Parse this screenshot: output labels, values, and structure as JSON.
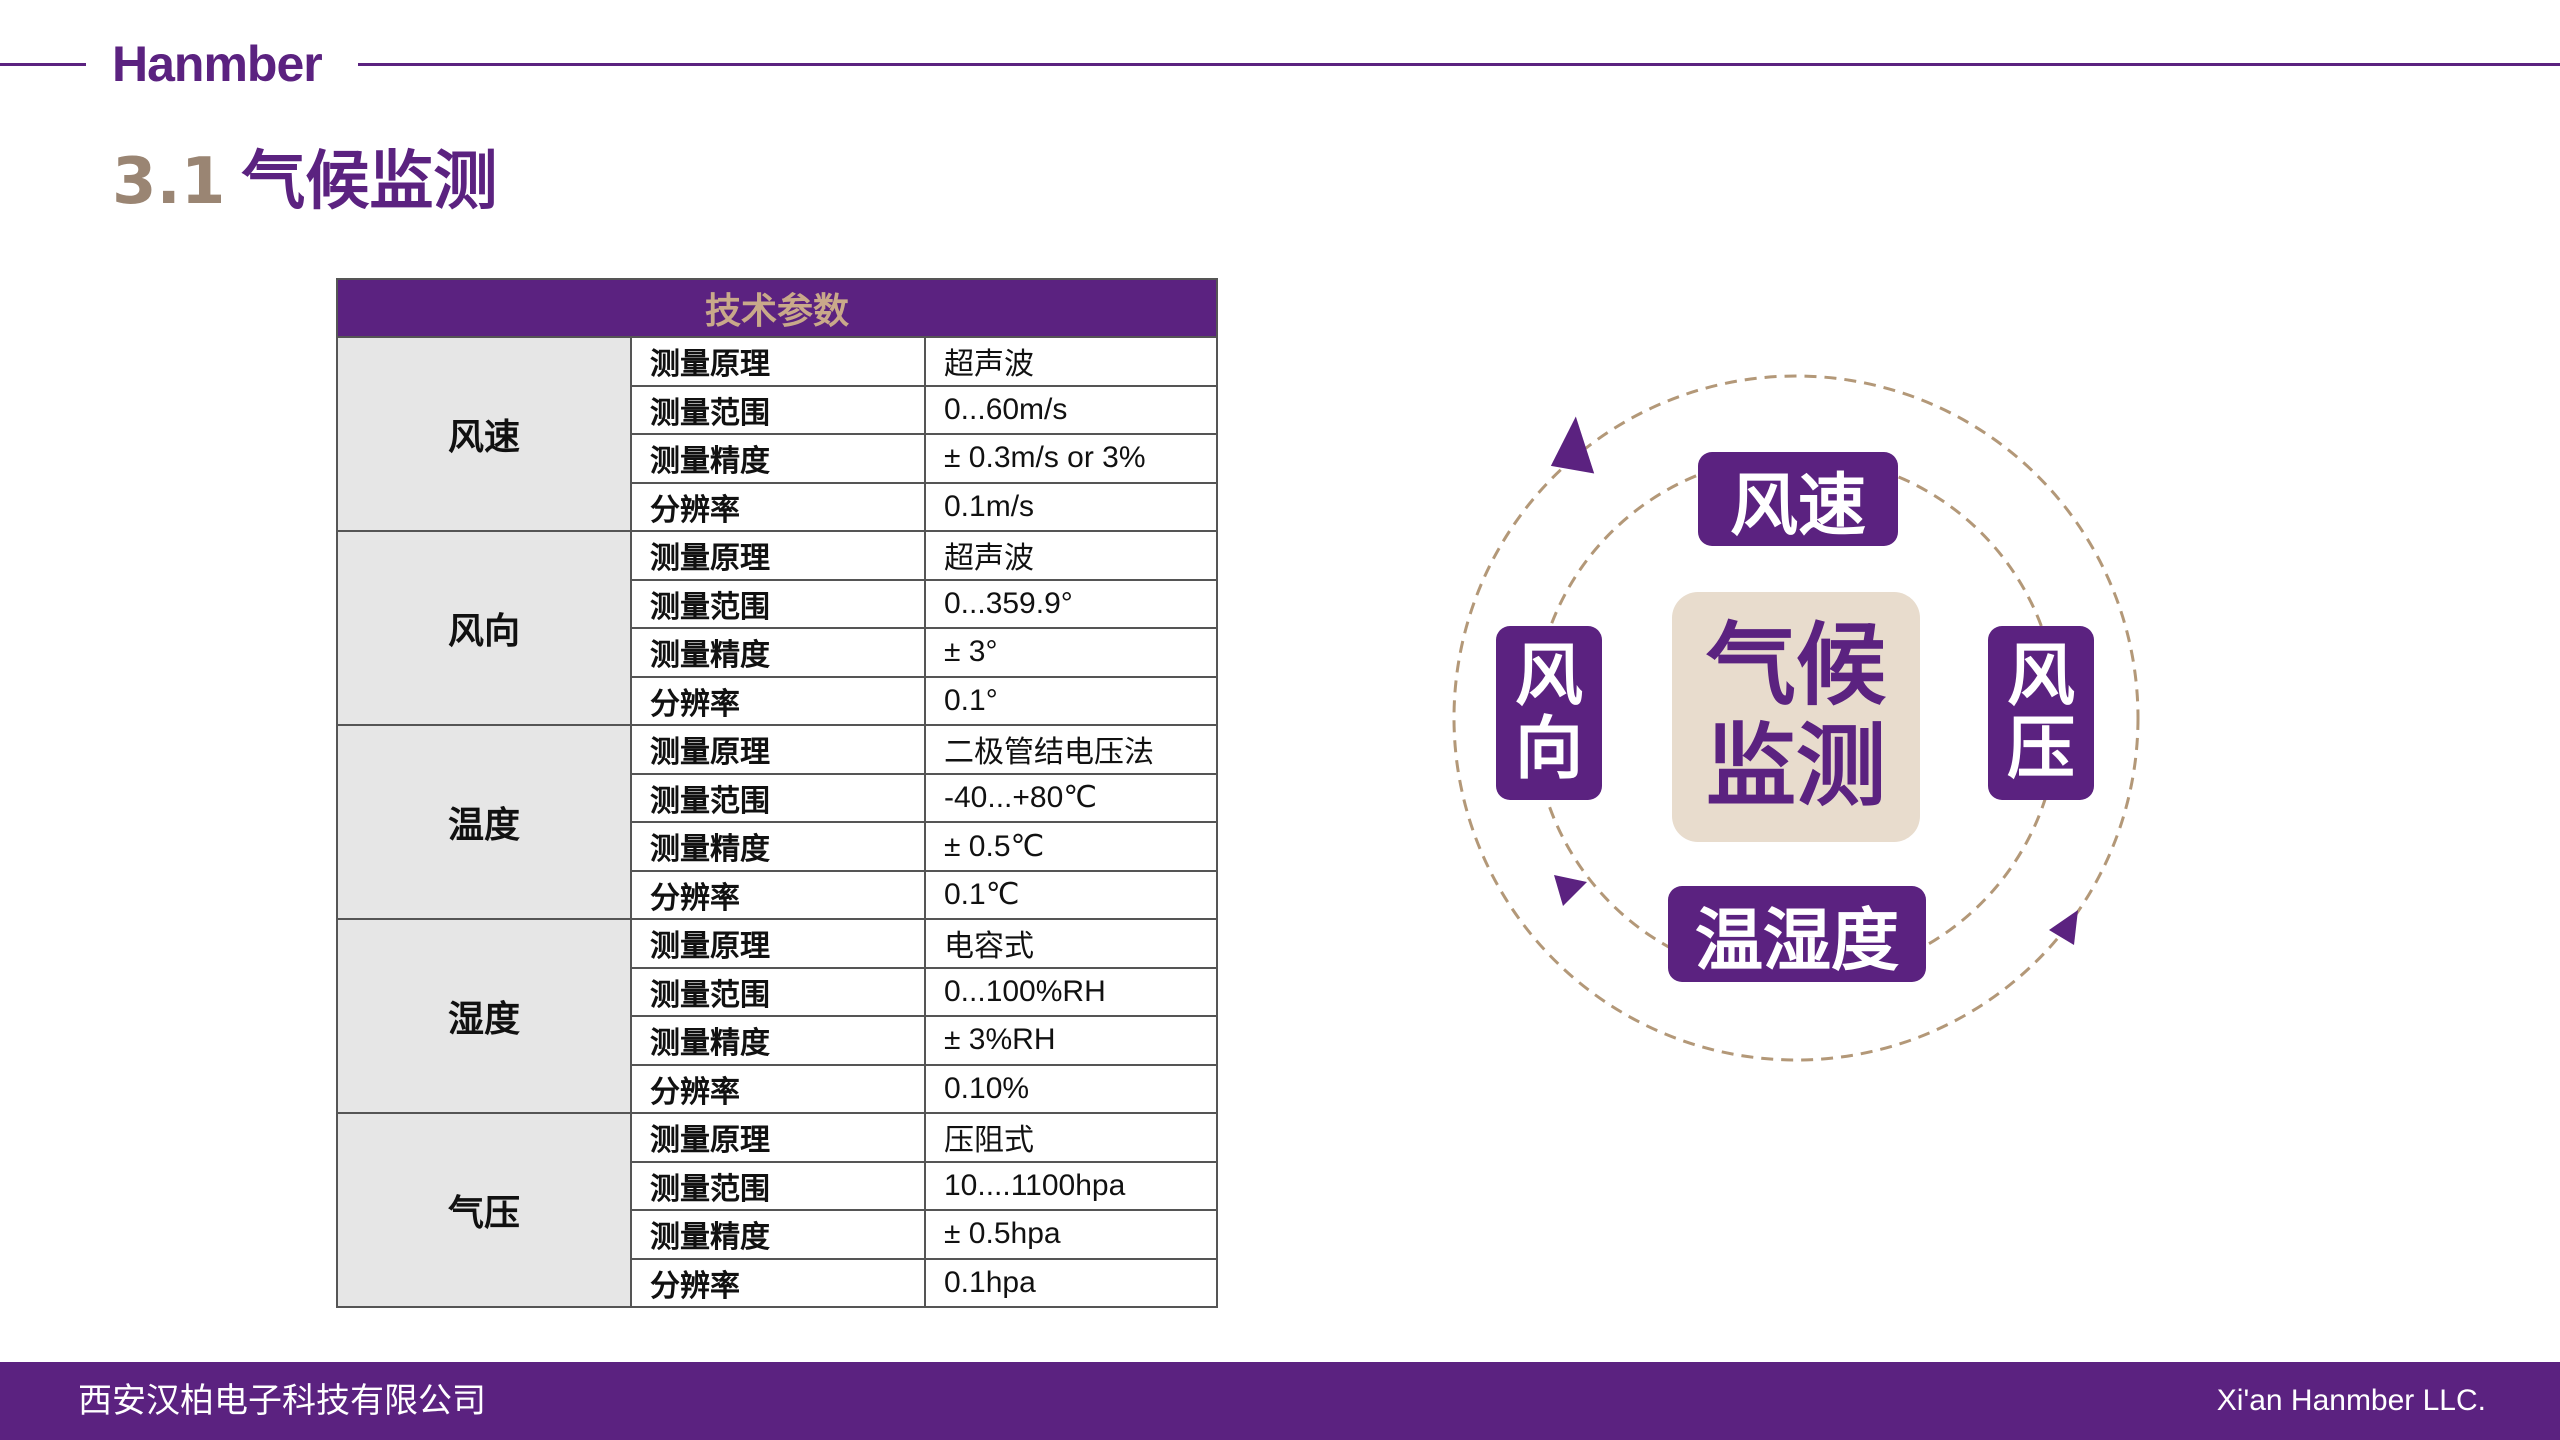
{
  "header": {
    "logo": "Hanmber"
  },
  "title": {
    "number": "3.1",
    "text": "气候监测"
  },
  "table": {
    "header": "技术参数",
    "groups": [
      {
        "name": "风速",
        "rows": [
          {
            "param": "测量原理",
            "value": "超声波"
          },
          {
            "param": "测量范围",
            "value": "0...60m/s"
          },
          {
            "param": "测量精度",
            "value": "± 0.3m/s or 3%"
          },
          {
            "param": "分辨率",
            "value": "0.1m/s"
          }
        ]
      },
      {
        "name": "风向",
        "rows": [
          {
            "param": "测量原理",
            "value": "超声波"
          },
          {
            "param": "测量范围",
            "value": "0...359.9°"
          },
          {
            "param": "测量精度",
            "value": "± 3°"
          },
          {
            "param": "分辨率",
            "value": "0.1°"
          }
        ]
      },
      {
        "name": "温度",
        "rows": [
          {
            "param": "测量原理",
            "value": "二极管结电压法"
          },
          {
            "param": "测量范围",
            "value": "-40...+80℃"
          },
          {
            "param": "测量精度",
            "value": "± 0.5℃"
          },
          {
            "param": "分辨率",
            "value": "0.1℃"
          }
        ]
      },
      {
        "name": "湿度",
        "rows": [
          {
            "param": "测量原理",
            "value": "电容式"
          },
          {
            "param": "测量范围",
            "value": "0...100%RH"
          },
          {
            "param": "测量精度",
            "value": "± 3%RH"
          },
          {
            "param": "分辨率",
            "value": "0.10%"
          }
        ]
      },
      {
        "name": "气压",
        "rows": [
          {
            "param": "测量原理",
            "value": "压阻式"
          },
          {
            "param": "测量范围",
            "value": "10....1100hpa"
          },
          {
            "param": "测量精度",
            "value": "± 0.5hpa"
          },
          {
            "param": "分辨率",
            "value": "0.1hpa"
          }
        ]
      }
    ]
  },
  "diagram": {
    "center": [
      "气候",
      "监测"
    ],
    "top": "风速",
    "left": [
      "风",
      "向"
    ],
    "right": [
      "风",
      "压"
    ],
    "bottom": "温湿度"
  },
  "footer": {
    "left": "西安汉柏电子科技有限公司",
    "right": "Xi'an Hanmber LLC."
  },
  "colors": {
    "brand_purple": "#5b2280",
    "accent_tan": "#9a8573",
    "center_fill": "#e8dccd",
    "dash_ring": "#b39878"
  }
}
